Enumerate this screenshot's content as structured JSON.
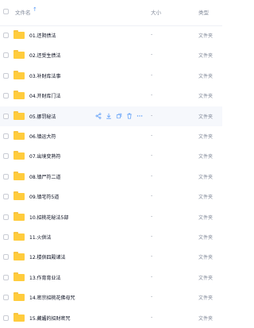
{
  "header": {
    "name_label": "文件名",
    "size_label": "大小",
    "type_label": "类型"
  },
  "colors": {
    "accent": "#5a9cf8",
    "folder": "#ffcc3d",
    "hover_row": "#f6f8fc",
    "muted_text": "#818999"
  },
  "hover_actions": [
    "share-icon",
    "download-icon",
    "copy-icon",
    "delete-icon",
    "more-icon"
  ],
  "rows": [
    {
      "name": "01.还阴债法",
      "size": "-",
      "type": "文件夹"
    },
    {
      "name": "02.还受生债法",
      "size": "-",
      "type": "文件夹"
    },
    {
      "name": "03.补财库法事",
      "size": "-",
      "type": "文件夹"
    },
    {
      "name": "04.开财库门法",
      "size": "-",
      "type": "文件夹"
    },
    {
      "name": "05.挪罚秘法",
      "size": "-",
      "type": "文件夹"
    },
    {
      "name": "06.镇运大符",
      "size": "-",
      "type": "文件夹"
    },
    {
      "name": "07.出境变熟符",
      "size": "-",
      "type": "文件夹"
    },
    {
      "name": "08.镇尸符二道",
      "size": "-",
      "type": "文件夹"
    },
    {
      "name": "09.镇宅符5道",
      "size": "-",
      "type": "文件夹"
    },
    {
      "name": "10.招桃花秘法5部",
      "size": "-",
      "type": "文件夹"
    },
    {
      "name": "11.火供法",
      "size": "-",
      "type": "文件夹"
    },
    {
      "name": "12.楼供四殿诸法",
      "size": "-",
      "type": "文件夹"
    },
    {
      "name": "13.作育育业法",
      "size": "-",
      "type": "文件夹"
    },
    {
      "name": "14.密宗招桃花佛母咒",
      "size": "-",
      "type": "文件夹"
    },
    {
      "name": "15.藏媚的招财密咒",
      "size": "-",
      "type": "文件夹"
    }
  ]
}
